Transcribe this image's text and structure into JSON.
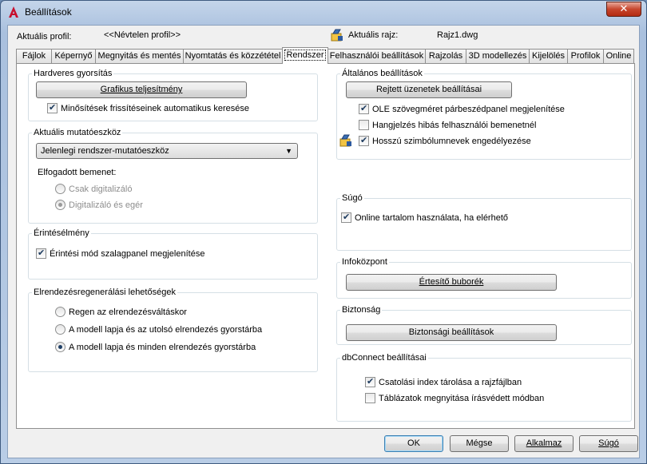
{
  "window": {
    "title": "Beállítások",
    "close_glyph": "✕"
  },
  "profile": {
    "current_profile_label": "Aktuális profil:",
    "current_profile_value": "<<Névtelen profil>>",
    "current_drawing_label": "Aktuális rajz:",
    "current_drawing_value": "Rajz1.dwg"
  },
  "tabs": [
    "Fájlok",
    "Képernyő",
    "Megnyitás és mentés",
    "Nyomtatás és közzététel",
    "Rendszer",
    "Felhasználói beállítások",
    "Rajzolás",
    "3D modellezés",
    "Kijelölés",
    "Profilok",
    "Online"
  ],
  "active_tab": "Rendszer",
  "hardware": {
    "legend": "Hardveres gyorsítás",
    "button": "Grafikus teljesítmény",
    "check_updates": {
      "label": "Minősítések frissítéseinek automatikus keresése",
      "checked": true
    }
  },
  "pointing": {
    "legend": "Aktuális mutatóeszköz",
    "selected": "Jelenlegi rendszer-mutatóeszköz",
    "accepted_label": "Elfogadott bemenet:",
    "options": [
      {
        "label": "Csak digitalizáló",
        "selected": false
      },
      {
        "label": "Digitalizáló és egér",
        "selected": true
      }
    ]
  },
  "touch": {
    "legend": "Érintésélmény",
    "check": {
      "label": "Érintési mód szalagpanel megjelenítése",
      "checked": true
    }
  },
  "layout_regen": {
    "legend": "Elrendezésregenerálási lehetőségek",
    "options": [
      {
        "label": "Regen az elrendezésváltáskor",
        "selected": false
      },
      {
        "label": "A modell lapja és az utolsó elrendezés gyorstárba",
        "selected": false
      },
      {
        "label": "A modell lapja és minden elrendezés gyorstárba",
        "selected": true
      }
    ]
  },
  "general": {
    "legend": "Általános beállítások",
    "button": "Rejtett üzenetek beállításai",
    "checks": [
      {
        "label": "OLE szövegméret párbeszédpanel megjelenítése",
        "checked": true
      },
      {
        "label": "Hangjelzés hibás felhasználói bemenetnél",
        "checked": false
      },
      {
        "label": "Hosszú szimbólumnevek engedélyezése",
        "checked": true
      }
    ]
  },
  "help": {
    "legend": "Súgó",
    "check": {
      "label": "Online tartalom használata, ha elérhető",
      "checked": true
    }
  },
  "infocenter": {
    "legend": "Infoközpont",
    "button": "Értesítő buborék"
  },
  "security": {
    "legend": "Biztonság",
    "button": "Biztonsági beállítások"
  },
  "dbconnect": {
    "legend": "dbConnect beállításai",
    "checks": [
      {
        "label": "Csatolási index tárolása a rajzfájlban",
        "checked": true
      },
      {
        "label": "Táblázatok megnyitása írásvédett módban",
        "checked": false
      }
    ]
  },
  "footer": {
    "ok": "OK",
    "cancel": "Mégse",
    "apply": "Alkalmaz",
    "help": "Súgó"
  },
  "colors": {
    "accent": "#3c7fb1",
    "title_bar": "#b9cde6",
    "close_red": "#c7462d"
  }
}
